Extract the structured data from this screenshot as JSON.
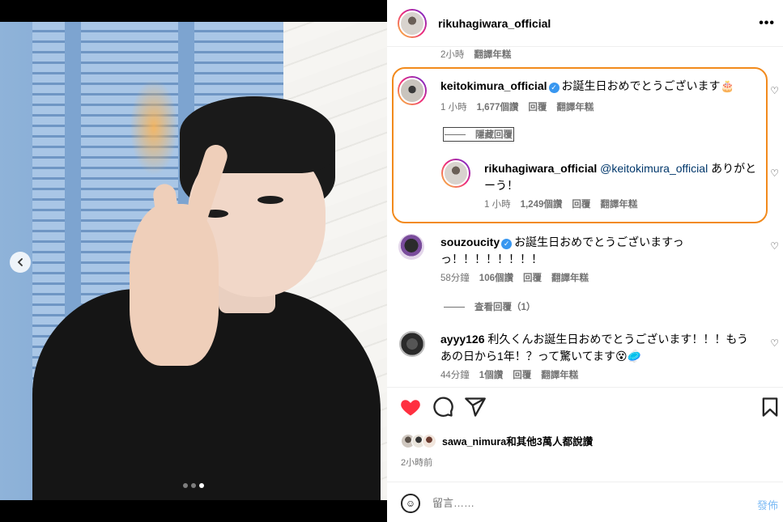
{
  "post": {
    "author": "rikuhagiwara_official",
    "more_label": "•••",
    "top_meta": {
      "time": "2小時",
      "translate": "翻譯年糕"
    }
  },
  "comments": [
    {
      "user": "keitokimura_official",
      "verified": true,
      "text": "お誕生日おめでとうございます🎂",
      "meta": {
        "time": "1 小時",
        "likes": "1,677個讚",
        "reply": "回覆",
        "translate": "翻譯年糕"
      },
      "hide_replies": "隱藏回覆",
      "reply_item": {
        "user": "rikuhagiwara_official",
        "mention": "@keitokimura_official",
        "text_line1": " ありがと",
        "text_line2": "ーう！",
        "meta": {
          "time": "1 小時",
          "likes": "1,249個讚",
          "reply": "回覆",
          "translate": "翻譯年糕"
        }
      }
    },
    {
      "user": "souzoucity",
      "verified": true,
      "text_line1": "お誕生日おめでとうございますっ",
      "text_line2": "っ！！！！！！！！",
      "meta": {
        "time": "58分鐘",
        "likes": "106個讚",
        "reply": "回覆",
        "translate": "翻譯年糕"
      },
      "view_replies": "查看回覆（1）"
    },
    {
      "user": "ayyy126",
      "text_line1": "利久くんお誕生日おめでとうございます！！！もう",
      "text_line2": "あの日から1年！？って驚いてます😵🥏",
      "meta": {
        "time": "44分鐘",
        "likes": "1個讚",
        "reply": "回覆",
        "translate": "翻譯年糕"
      }
    }
  ],
  "likes": {
    "text": "sawa_nimura和其他3萬人都說讚"
  },
  "posted_time": "2小時前",
  "compose": {
    "placeholder": "留言……",
    "post_label": "發佈"
  },
  "carousel": {
    "total": 3,
    "active": 3
  },
  "icons": {
    "like": "heart-filled-icon",
    "comment": "comment-icon",
    "share": "send-icon",
    "save": "bookmark-icon",
    "emoji": "emoji-icon"
  },
  "colors": {
    "liked": "#ff3040",
    "highlight": "#f28a1c",
    "verified": "#3897f0"
  }
}
